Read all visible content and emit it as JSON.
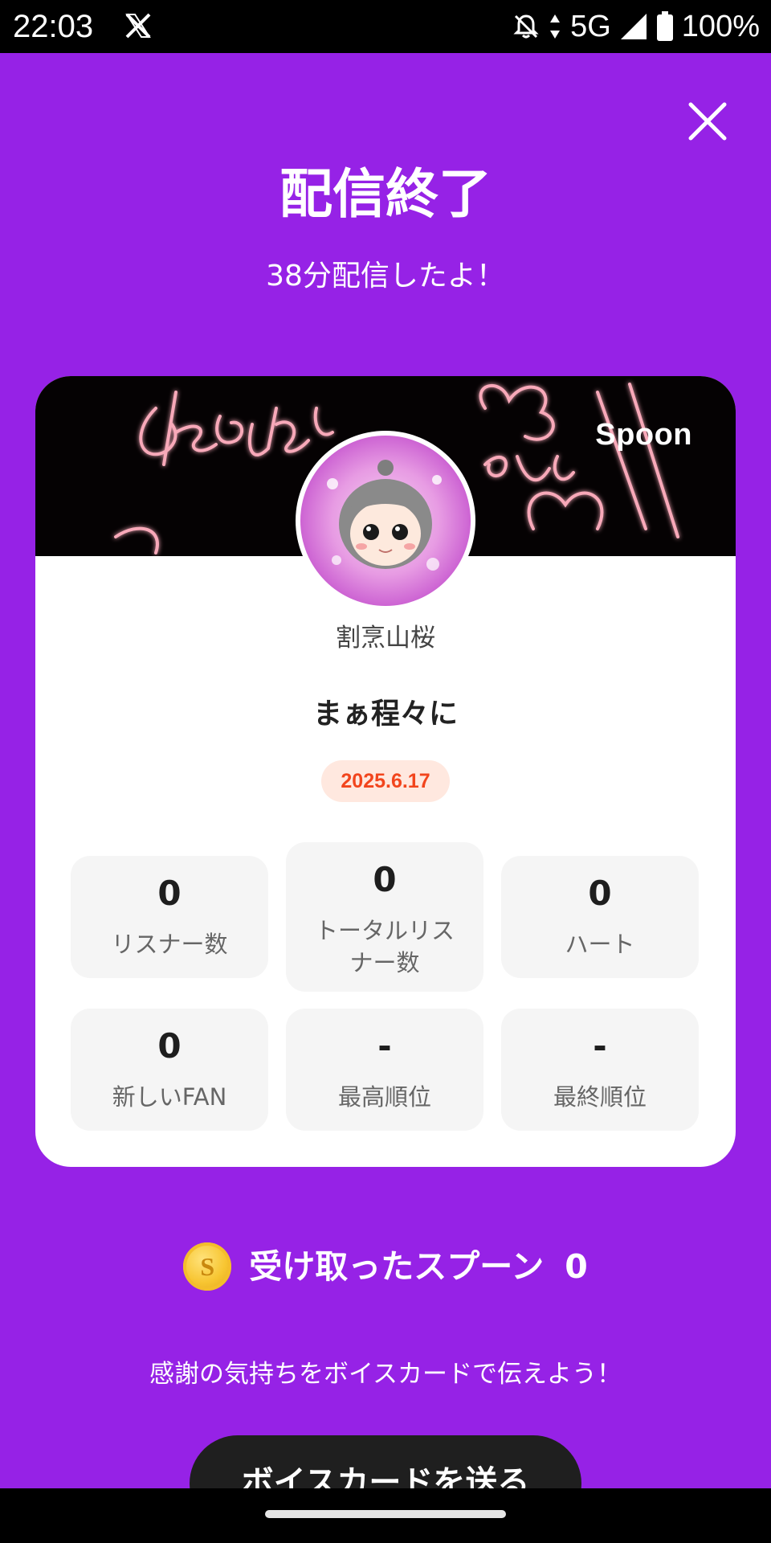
{
  "status_bar": {
    "time": "22:03",
    "network": "5G",
    "battery": "100%"
  },
  "header": {
    "title": "配信終了",
    "subtitle": "38分配信したよ！"
  },
  "card": {
    "brand": "Spoon",
    "host_name": "割烹山桜",
    "live_title": "まぁ程々に",
    "date": "2025.6.17",
    "stats": [
      {
        "value": "0",
        "label": "リスナー数"
      },
      {
        "value": "0",
        "label": "トータルリス\nナー数"
      },
      {
        "value": "0",
        "label": "ハート"
      },
      {
        "value": "0",
        "label": "新しいFAN"
      },
      {
        "value": "-",
        "label": "最高順位"
      },
      {
        "value": "-",
        "label": "最終順位"
      }
    ]
  },
  "spoons": {
    "coin_symbol": "S",
    "label": "受け取ったスプーン",
    "count": "0"
  },
  "thanks_text": "感謝の気持ちをボイスカードで伝えよう！",
  "voice_card_button": "ボイスカードを送る",
  "colors": {
    "background": "#9622e6",
    "date_text": "#f2451d",
    "date_bg": "#ffe8df"
  }
}
